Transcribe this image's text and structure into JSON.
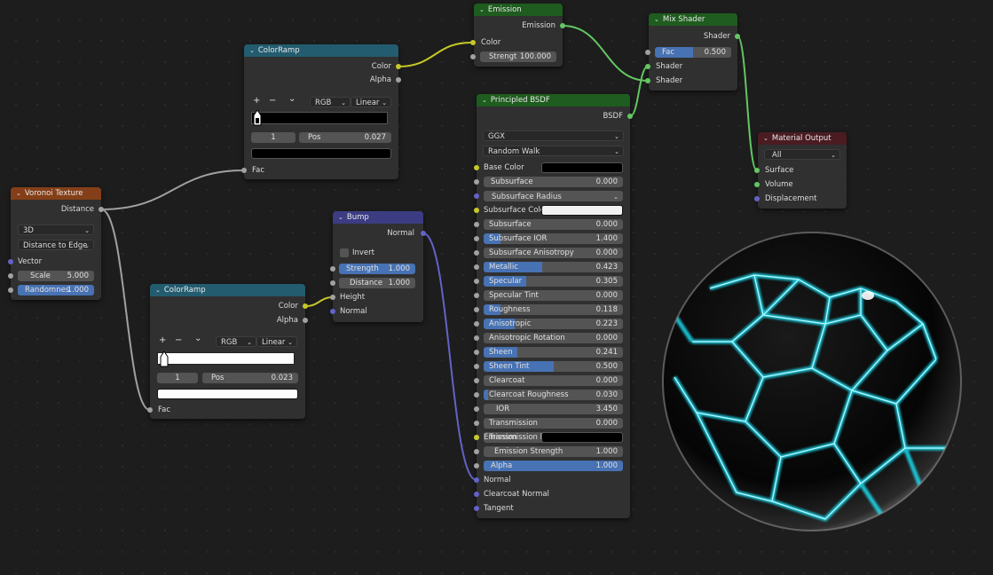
{
  "colors": {
    "background": "#1d1d1d",
    "node_body": "#303030",
    "field": "#545454",
    "accent_blue": "#4772b3",
    "header_converter": "#235c6e",
    "header_texture": "#843f18",
    "header_shader": "#1f5c1f",
    "header_vector": "#3c3c83",
    "header_output": "#4a1c22",
    "socket_gray": "#a1a1a1",
    "socket_yellow": "#c7c729",
    "socket_green": "#63c763",
    "socket_purple": "#6363c7",
    "glow": "#1de9ff"
  },
  "voronoi": {
    "title": "Voronoi Texture",
    "out_distance": "Distance",
    "dim": "3D",
    "feature": "Distance to Edge",
    "in_vector": "Vector",
    "scale_label": "Scale",
    "scale_value": "5.000",
    "random_label": "Randomnes",
    "random_value": "1.000"
  },
  "ramp1": {
    "title": "ColorRamp",
    "out_color": "Color",
    "out_alpha": "Alpha",
    "mode": "RGB",
    "interp": "Linear",
    "index": "1",
    "pos_label": "Pos",
    "pos_value": "0.027",
    "in_fac": "Fac",
    "stop_color": "#000000"
  },
  "ramp2": {
    "title": "ColorRamp",
    "out_color": "Color",
    "out_alpha": "Alpha",
    "mode": "RGB",
    "interp": "Linear",
    "index": "1",
    "pos_label": "Pos",
    "pos_value": "0.023",
    "in_fac": "Fac",
    "stop_color": "#ffffff"
  },
  "emission": {
    "title": "Emission",
    "out": "Emission",
    "in_color": "Color",
    "strength_label": "Strengt",
    "strength_value": "100.000"
  },
  "bump": {
    "title": "Bump",
    "out": "Normal",
    "invert": "Invert",
    "strength_label": "Strength",
    "strength_value": "1.000",
    "distance_label": "Distance",
    "distance_value": "1.000",
    "in_height": "Height",
    "in_normal": "Normal"
  },
  "principled": {
    "title": "Principled BSDF",
    "out": "BSDF",
    "distribution": "GGX",
    "sss_method": "Random Walk",
    "base_color": "Base Color",
    "base_color_value": "#000000",
    "subsurface_colo_label": "Subsurface Colo",
    "subsurface_colo_value": "#f2f2f2",
    "subsurface_radius": "Subsurface Radius",
    "params": [
      {
        "label": "Subsurface",
        "value": "0.000",
        "fill": 0
      },
      {
        "label": "Subsurface IOR",
        "value": "1.400",
        "fill": 0.12
      },
      {
        "label": "Subsurface Anisotropy",
        "value": "0.000",
        "fill": 0
      },
      {
        "label": "Metallic",
        "value": "0.423",
        "fill": 0.423
      },
      {
        "label": "Specular",
        "value": "0.305",
        "fill": 0.305
      },
      {
        "label": "Specular Tint",
        "value": "0.000",
        "fill": 0
      },
      {
        "label": "Roughness",
        "value": "0.118",
        "fill": 0.118
      },
      {
        "label": "Anisotropic",
        "value": "0.223",
        "fill": 0.223
      },
      {
        "label": "Anisotropic Rotation",
        "value": "0.000",
        "fill": 0
      },
      {
        "label": "Sheen",
        "value": "0.241",
        "fill": 0.241
      },
      {
        "label": "Sheen Tint",
        "value": "0.500",
        "fill": 0.5
      },
      {
        "label": "Clearcoat",
        "value": "0.000",
        "fill": 0
      },
      {
        "label": "Clearcoat Roughness",
        "value": "0.030",
        "fill": 0.03
      },
      {
        "label": "IOR",
        "value": "3.450",
        "fill": 0
      }
    ],
    "params2": [
      {
        "label": "Transmission",
        "value": "0.000",
        "fill": 0
      },
      {
        "label": "Transmission Roughness",
        "value": "0.000",
        "fill": 0
      }
    ],
    "emission": "Emission",
    "emission_color": "#000000",
    "emission_strength_label": "Emission Strength",
    "emission_strength_value": "1.000",
    "alpha_label": "Alpha",
    "alpha_value": "1.000",
    "alpha_fill": 1,
    "normal": "Normal",
    "clearcoat_normal": "Clearcoat Normal",
    "tangent": "Tangent"
  },
  "mix": {
    "title": "Mix Shader",
    "out": "Shader",
    "fac_label": "Fac",
    "fac_value": "0.500",
    "fac_fill": 0.5,
    "in_shader1": "Shader",
    "in_shader2": "Shader"
  },
  "output": {
    "title": "Material Output",
    "target": "All",
    "surface": "Surface",
    "volume": "Volume",
    "displacement": "Displacement"
  },
  "icons": {
    "add": "+",
    "remove": "−",
    "menu": "⌄",
    "chevron": "⌄"
  }
}
